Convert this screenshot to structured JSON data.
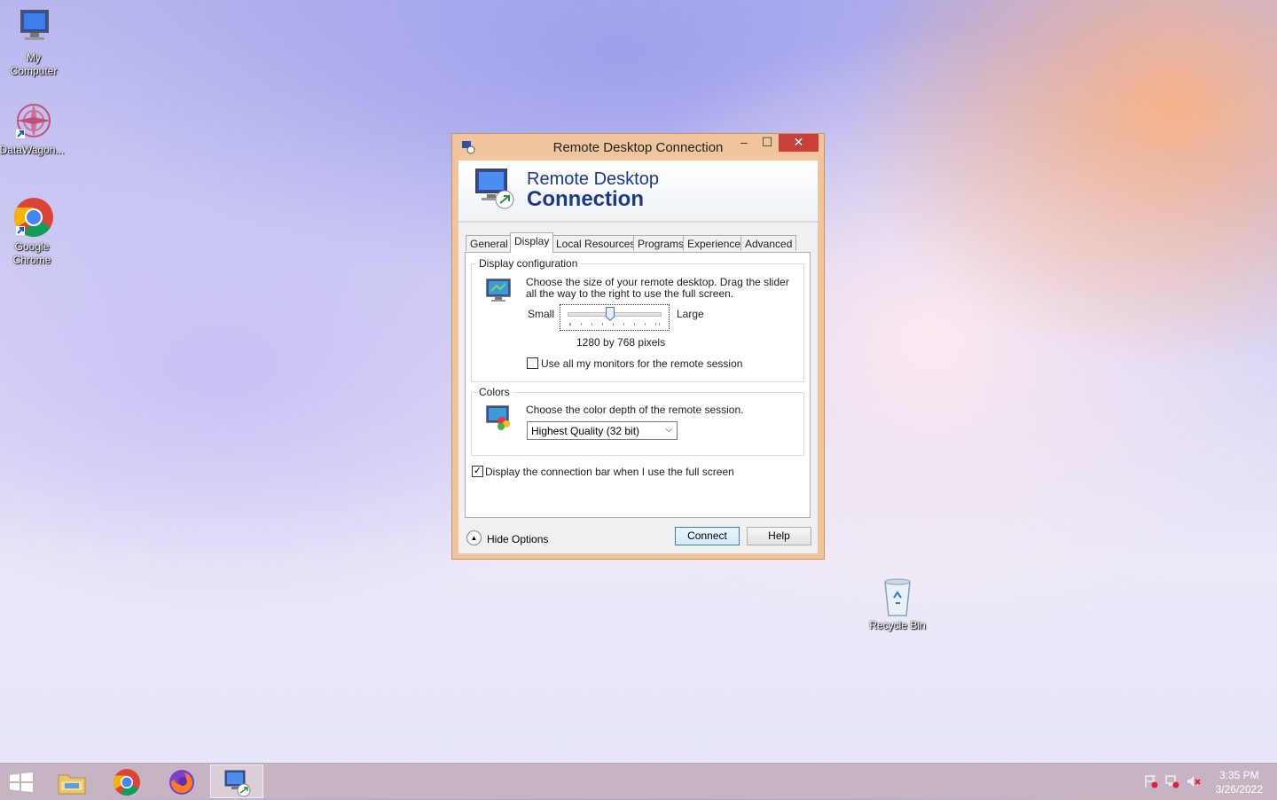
{
  "desktop": {
    "icons": [
      {
        "label": "My\nComputer",
        "line1": "My",
        "line2": "Computer"
      },
      {
        "label": "DataWagon...",
        "line1": "DataWagon..."
      },
      {
        "label": "Google Chrome",
        "line1": "Google",
        "line2": "Chrome"
      },
      {
        "label": "Recycle Bin",
        "line1": "Recycle Bin"
      }
    ]
  },
  "window": {
    "title": "Remote Desktop Connection",
    "banner_line1": "Remote Desktop",
    "banner_line2": "Connection",
    "tabs": [
      {
        "label": "General"
      },
      {
        "label": "Display",
        "active": true
      },
      {
        "label": "Local Resources"
      },
      {
        "label": "Programs"
      },
      {
        "label": "Experience"
      },
      {
        "label": "Advanced"
      }
    ],
    "display_config": {
      "label": "Display configuration",
      "description": "Choose the size of your remote desktop. Drag the slider all the way to the right to use the full screen.",
      "slider_min_label": "Small",
      "slider_max_label": "Large",
      "slider_value": 0.45,
      "resolution_text": "1280 by 768 pixels",
      "all_monitors_label": "Use all my monitors for the remote session",
      "all_monitors_checked": false
    },
    "colors": {
      "label": "Colors",
      "description": "Choose the color depth of the remote session.",
      "selected": "Highest Quality (32 bit)"
    },
    "connection_bar_label": "Display the connection bar when I use the full screen",
    "connection_bar_checked": true,
    "hide_options_label": "Hide Options",
    "connect_label": "Connect",
    "help_label": "Help"
  },
  "taskbar": {
    "time": "3:35 PM",
    "date": "3/26/2022"
  }
}
